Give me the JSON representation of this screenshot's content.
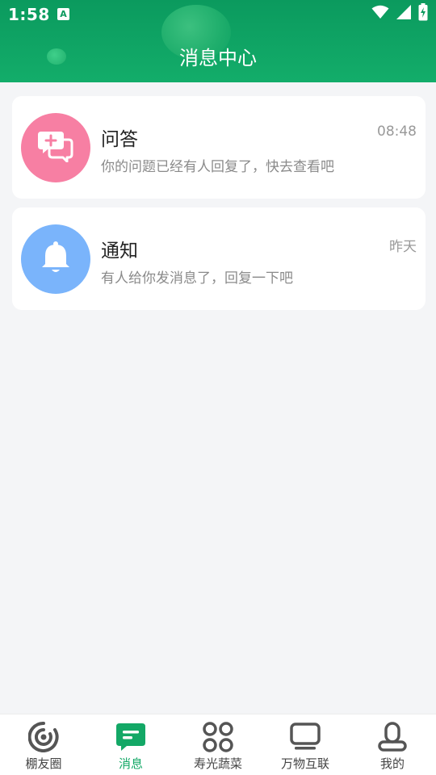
{
  "status_bar": {
    "time": "1:58",
    "app_indicator": "A"
  },
  "header": {
    "title": "消息中心"
  },
  "messages": [
    {
      "title": "问答",
      "description": "你的问题已经有人回复了，快去查看吧",
      "time": "08:48",
      "icon": "qa-chat-plus-icon",
      "icon_color": "#f77fa3"
    },
    {
      "title": "通知",
      "description": "有人给你发消息了，回复一下吧",
      "time": "昨天",
      "icon": "bell-icon",
      "icon_color": "#7ab4fb"
    }
  ],
  "tabs": [
    {
      "label": "棚友圈",
      "icon": "circle-camera-icon",
      "active": false
    },
    {
      "label": "消息",
      "icon": "message-icon",
      "active": true
    },
    {
      "label": "寿光蔬菜",
      "icon": "four-petal-grid-icon",
      "active": false
    },
    {
      "label": "万物互联",
      "icon": "monitor-icon",
      "active": false
    },
    {
      "label": "我的",
      "icon": "person-icon",
      "active": false
    }
  ],
  "colors": {
    "brand_green": "#13ad6a",
    "active_tab": "#13a866"
  }
}
